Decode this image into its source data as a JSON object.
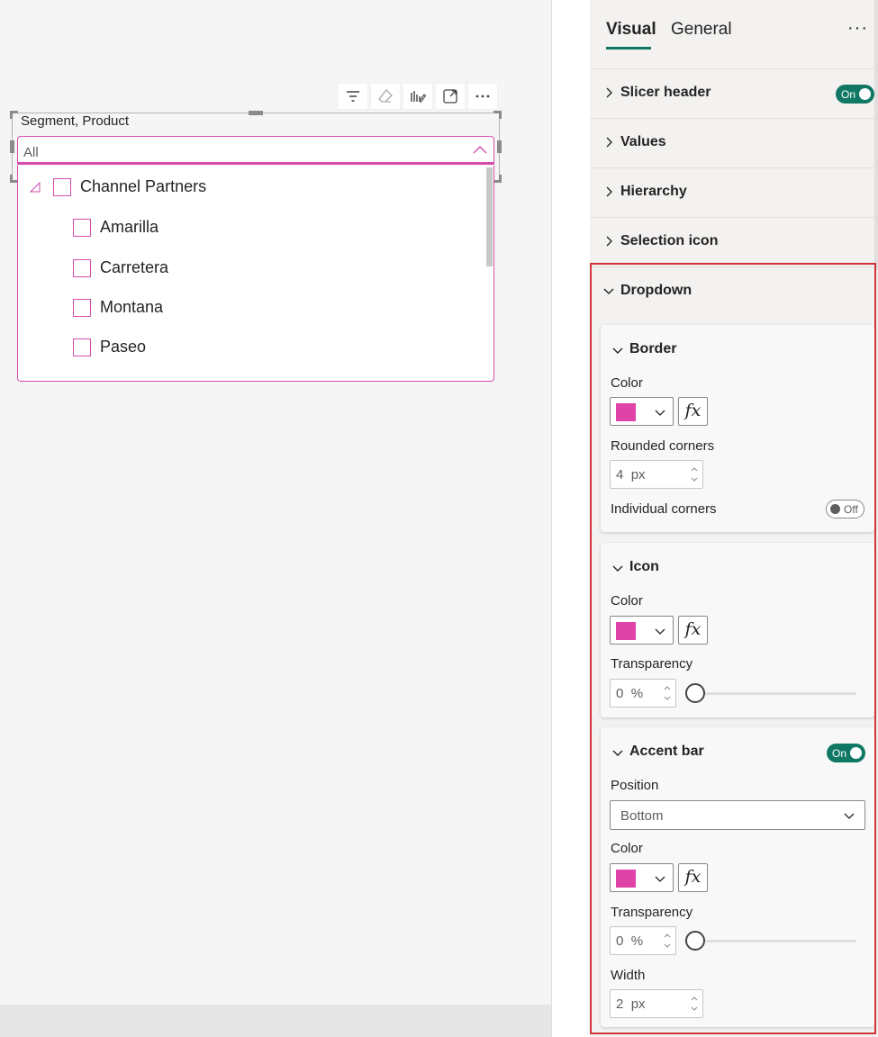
{
  "canvas": {
    "slicer": {
      "title": "Segment, Product",
      "dropdown_value": "All",
      "items": [
        {
          "label": "Channel Partners",
          "level": 0
        },
        {
          "label": "Amarilla",
          "level": 1
        },
        {
          "label": "Carretera",
          "level": 1
        },
        {
          "label": "Montana",
          "level": 1
        },
        {
          "label": "Paseo",
          "level": 1
        }
      ]
    },
    "toolbar_icons": [
      "filter-icon",
      "eraser-icon",
      "format-visual-icon",
      "focus-mode-icon",
      "more-options-icon"
    ]
  },
  "pane": {
    "tabs": [
      {
        "label": "Visual",
        "active": true
      },
      {
        "label": "General",
        "active": false
      }
    ],
    "more_label": "···",
    "sections": {
      "slicer_header": {
        "label": "Slicer header",
        "toggle": "On"
      },
      "values": {
        "label": "Values"
      },
      "hierarchy": {
        "label": "Hierarchy"
      },
      "selection_icon": {
        "label": "Selection icon"
      },
      "dropdown": {
        "label": "Dropdown",
        "expanded": true
      }
    },
    "border": {
      "title": "Border",
      "color_label": "Color",
      "color": "#e043a8",
      "fx_label": "fx",
      "rounded_label": "Rounded corners",
      "rounded_value": "4",
      "rounded_unit": "px",
      "individual_label": "Individual corners",
      "individual_toggle": "Off"
    },
    "icon": {
      "title": "Icon",
      "color_label": "Color",
      "color": "#e043a8",
      "fx_label": "fx",
      "transparency_label": "Transparency",
      "transparency_value": "0",
      "transparency_unit": "%",
      "transparency_fraction": 0
    },
    "accent_bar": {
      "title": "Accent bar",
      "toggle": "On",
      "position_label": "Position",
      "position_value": "Bottom",
      "color_label": "Color",
      "color": "#e043a8",
      "fx_label": "fx",
      "transparency_label": "Transparency",
      "transparency_value": "0",
      "transparency_unit": "%",
      "transparency_fraction": 0,
      "width_label": "Width",
      "width_value": "2",
      "width_unit": "px"
    }
  },
  "colors": {
    "accent": "#d64cae",
    "toggle_on": "#117865",
    "highlight": "#d13438"
  }
}
